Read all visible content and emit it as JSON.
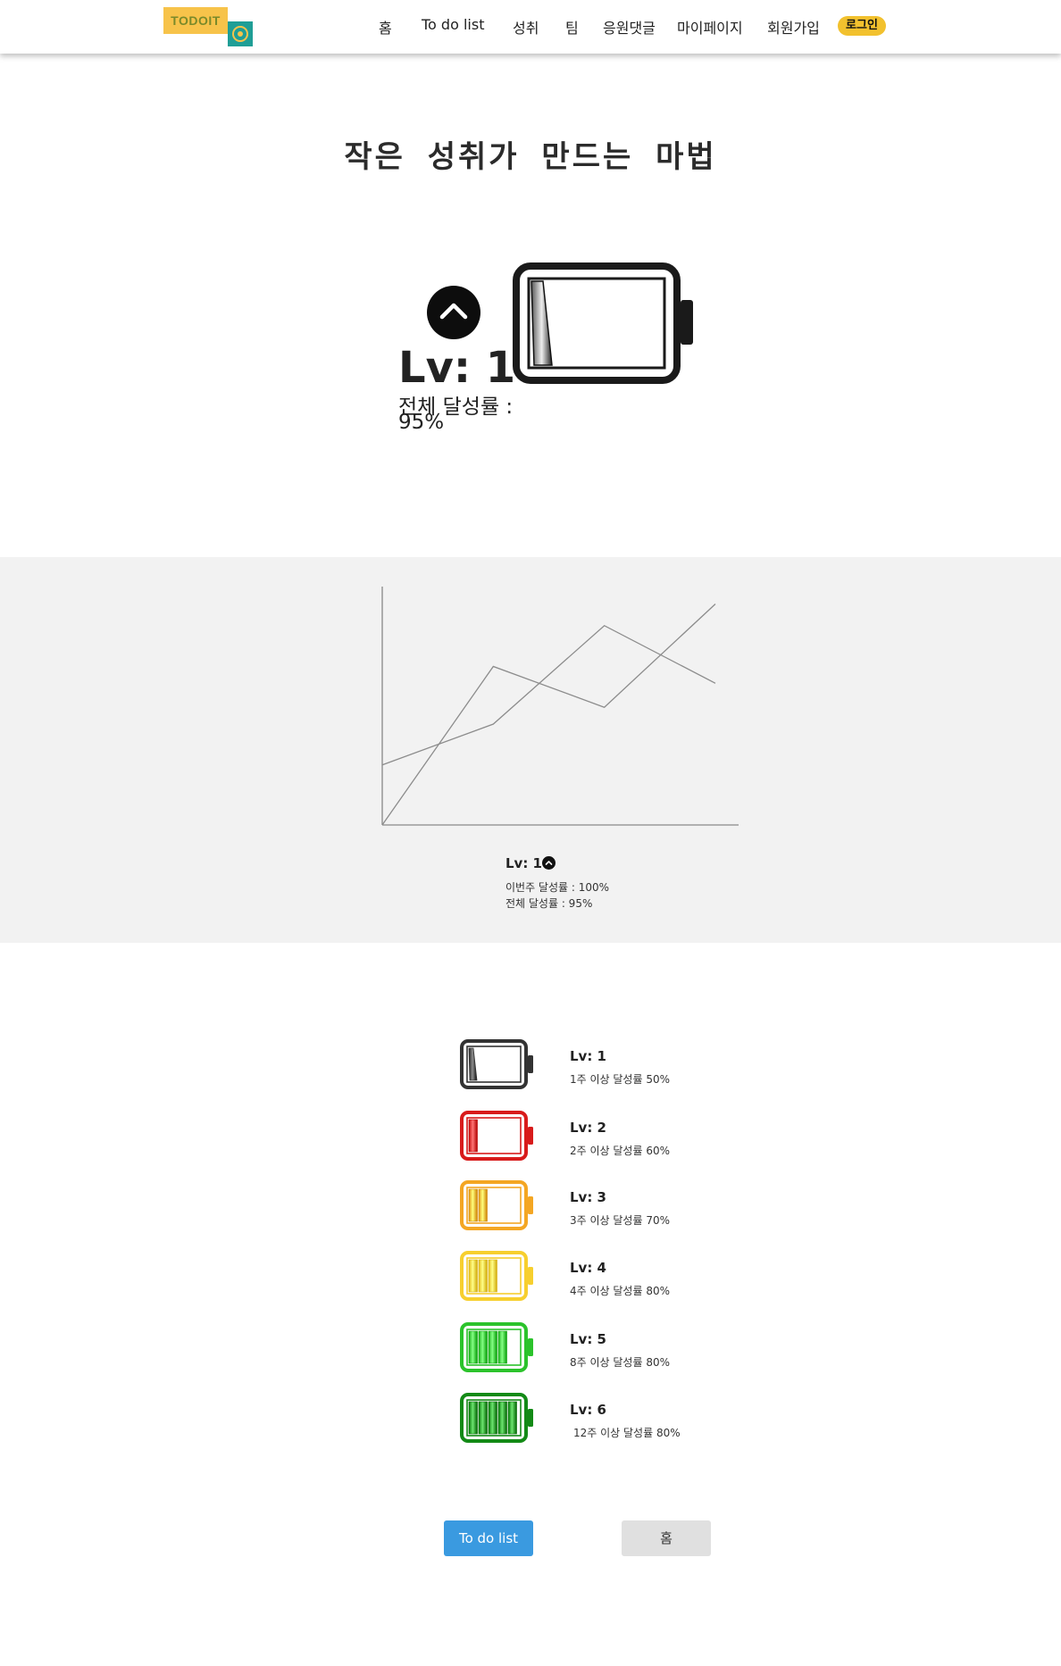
{
  "header": {
    "logo_text": "TODOIT",
    "nav": [
      "홈",
      "To do list",
      "성취",
      "팀",
      "응원댓글",
      "마이페이지",
      "회원가입"
    ],
    "login_label": "로그인"
  },
  "hero": {
    "title": "작은 성취가 만드는 마법",
    "level": "Lv: 1",
    "rate_label": "전체 달성률 :",
    "rate_value": "95%"
  },
  "chart_panel": {
    "level": "Lv: 1",
    "weekly_rate": "이번주 달성률 : 100%",
    "total_rate": "전체 달성률 : 95%"
  },
  "chart_data": {
    "type": "line",
    "x": [
      0,
      1,
      2,
      3
    ],
    "series": [
      {
        "values": [
          0,
          66,
          49,
          92
        ]
      },
      {
        "values": [
          25,
          42,
          83,
          59
        ]
      }
    ],
    "xlabel": "",
    "ylabel": "",
    "ylim": [
      0,
      100
    ],
    "grid": false
  },
  "levels": [
    {
      "title": "Lv: 1",
      "desc": "1주 이상 달성률 50%",
      "color": "#333333",
      "bars": 1
    },
    {
      "title": "Lv: 2",
      "desc": "2주 이상 달성률 60%",
      "color": "#d81b1b",
      "bars": 1
    },
    {
      "title": "Lv: 3",
      "desc": "3주 이상 달성률 70%",
      "color": "#f4a623",
      "bars": 2
    },
    {
      "title": "Lv: 4",
      "desc": "4주 이상 달성률 80%",
      "color": "#f7cf2e",
      "bars": 3
    },
    {
      "title": "Lv: 5",
      "desc": "8주 이상 달성률 80%",
      "color": "#2bc32b",
      "bars": 4
    },
    {
      "title": "Lv: 6",
      "desc": "12주 이상 달성률 80%",
      "color": "#138a16",
      "bars": 5
    }
  ],
  "buttons": {
    "todo": "To do list",
    "home": "홈"
  }
}
